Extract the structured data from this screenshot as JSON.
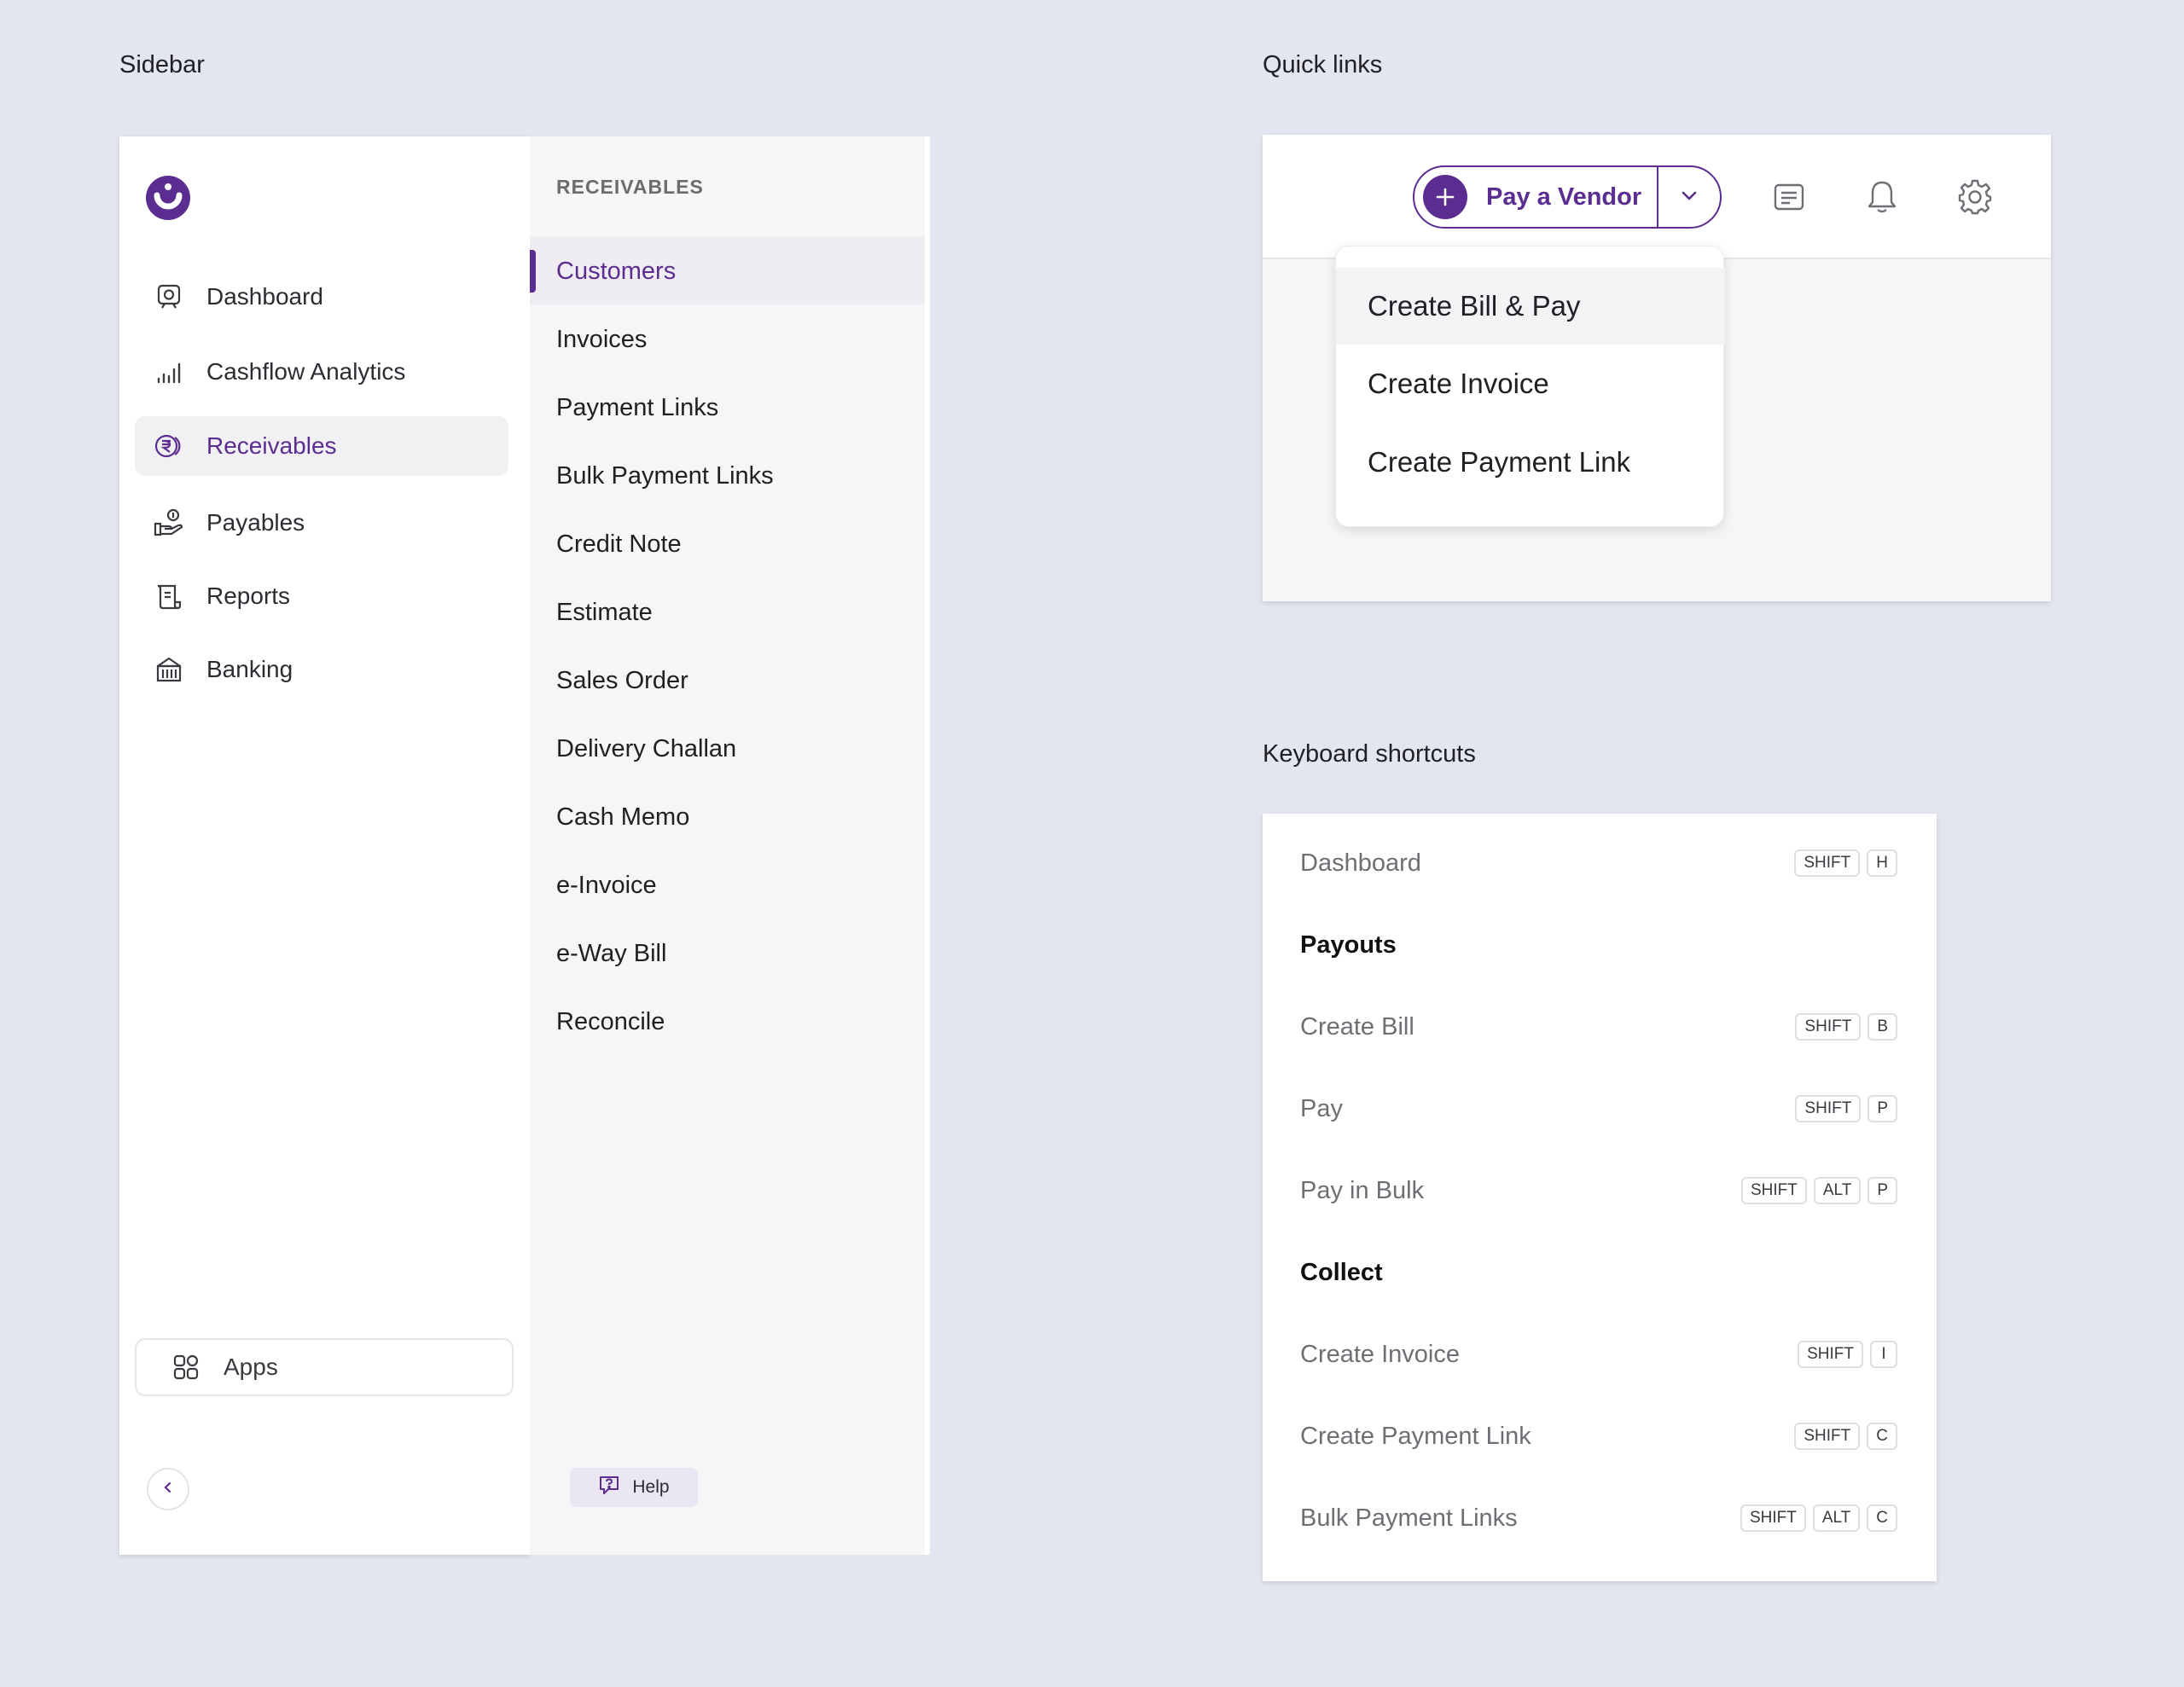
{
  "section_labels": {
    "sidebar": "Sidebar",
    "quick_links": "Quick links",
    "keyboard_shortcuts": "Keyboard shortcuts"
  },
  "brand": {
    "accent": "#5c2d91"
  },
  "sidebar": {
    "items": [
      {
        "label": "Dashboard",
        "icon": "dashboard-icon",
        "active": false
      },
      {
        "label": "Cashflow Analytics",
        "icon": "analytics-icon",
        "active": false
      },
      {
        "label": "Receivables",
        "icon": "rupee-coins-icon",
        "active": true
      },
      {
        "label": "Payables",
        "icon": "hand-coin-icon",
        "active": false
      },
      {
        "label": "Reports",
        "icon": "scroll-icon",
        "active": false
      },
      {
        "label": "Banking",
        "icon": "bank-icon",
        "active": false
      }
    ],
    "apps_label": "Apps"
  },
  "subnav": {
    "title": "RECEIVABLES",
    "items": [
      "Customers",
      "Invoices",
      "Payment Links",
      "Bulk Payment Links",
      "Credit Note",
      "Estimate",
      "Sales Order",
      "Delivery Challan",
      "Cash Memo",
      "e-Invoice",
      "e-Way Bill",
      "Reconcile"
    ],
    "active_index": 0,
    "help_label": "Help"
  },
  "quick_links": {
    "primary_label": "Pay a Vendor",
    "dropdown": [
      "Create Bill & Pay",
      "Create Invoice",
      "Create Payment Link"
    ],
    "hover_index": 0
  },
  "shortcuts": {
    "rows": [
      {
        "type": "item",
        "label": "Dashboard",
        "keys": [
          "SHIFT",
          "H"
        ]
      },
      {
        "type": "heading",
        "label": "Payouts"
      },
      {
        "type": "item",
        "label": "Create Bill",
        "keys": [
          "SHIFT",
          "B"
        ]
      },
      {
        "type": "item",
        "label": "Pay",
        "keys": [
          "SHIFT",
          "P"
        ]
      },
      {
        "type": "item",
        "label": "Pay in Bulk",
        "keys": [
          "SHIFT",
          "ALT",
          "P"
        ]
      },
      {
        "type": "heading",
        "label": "Collect"
      },
      {
        "type": "item",
        "label": "Create Invoice",
        "keys": [
          "SHIFT",
          "I"
        ]
      },
      {
        "type": "item",
        "label": "Create Payment Link",
        "keys": [
          "SHIFT",
          "C"
        ]
      },
      {
        "type": "item",
        "label": "Bulk Payment Links",
        "keys": [
          "SHIFT",
          "ALT",
          "C"
        ]
      }
    ]
  }
}
